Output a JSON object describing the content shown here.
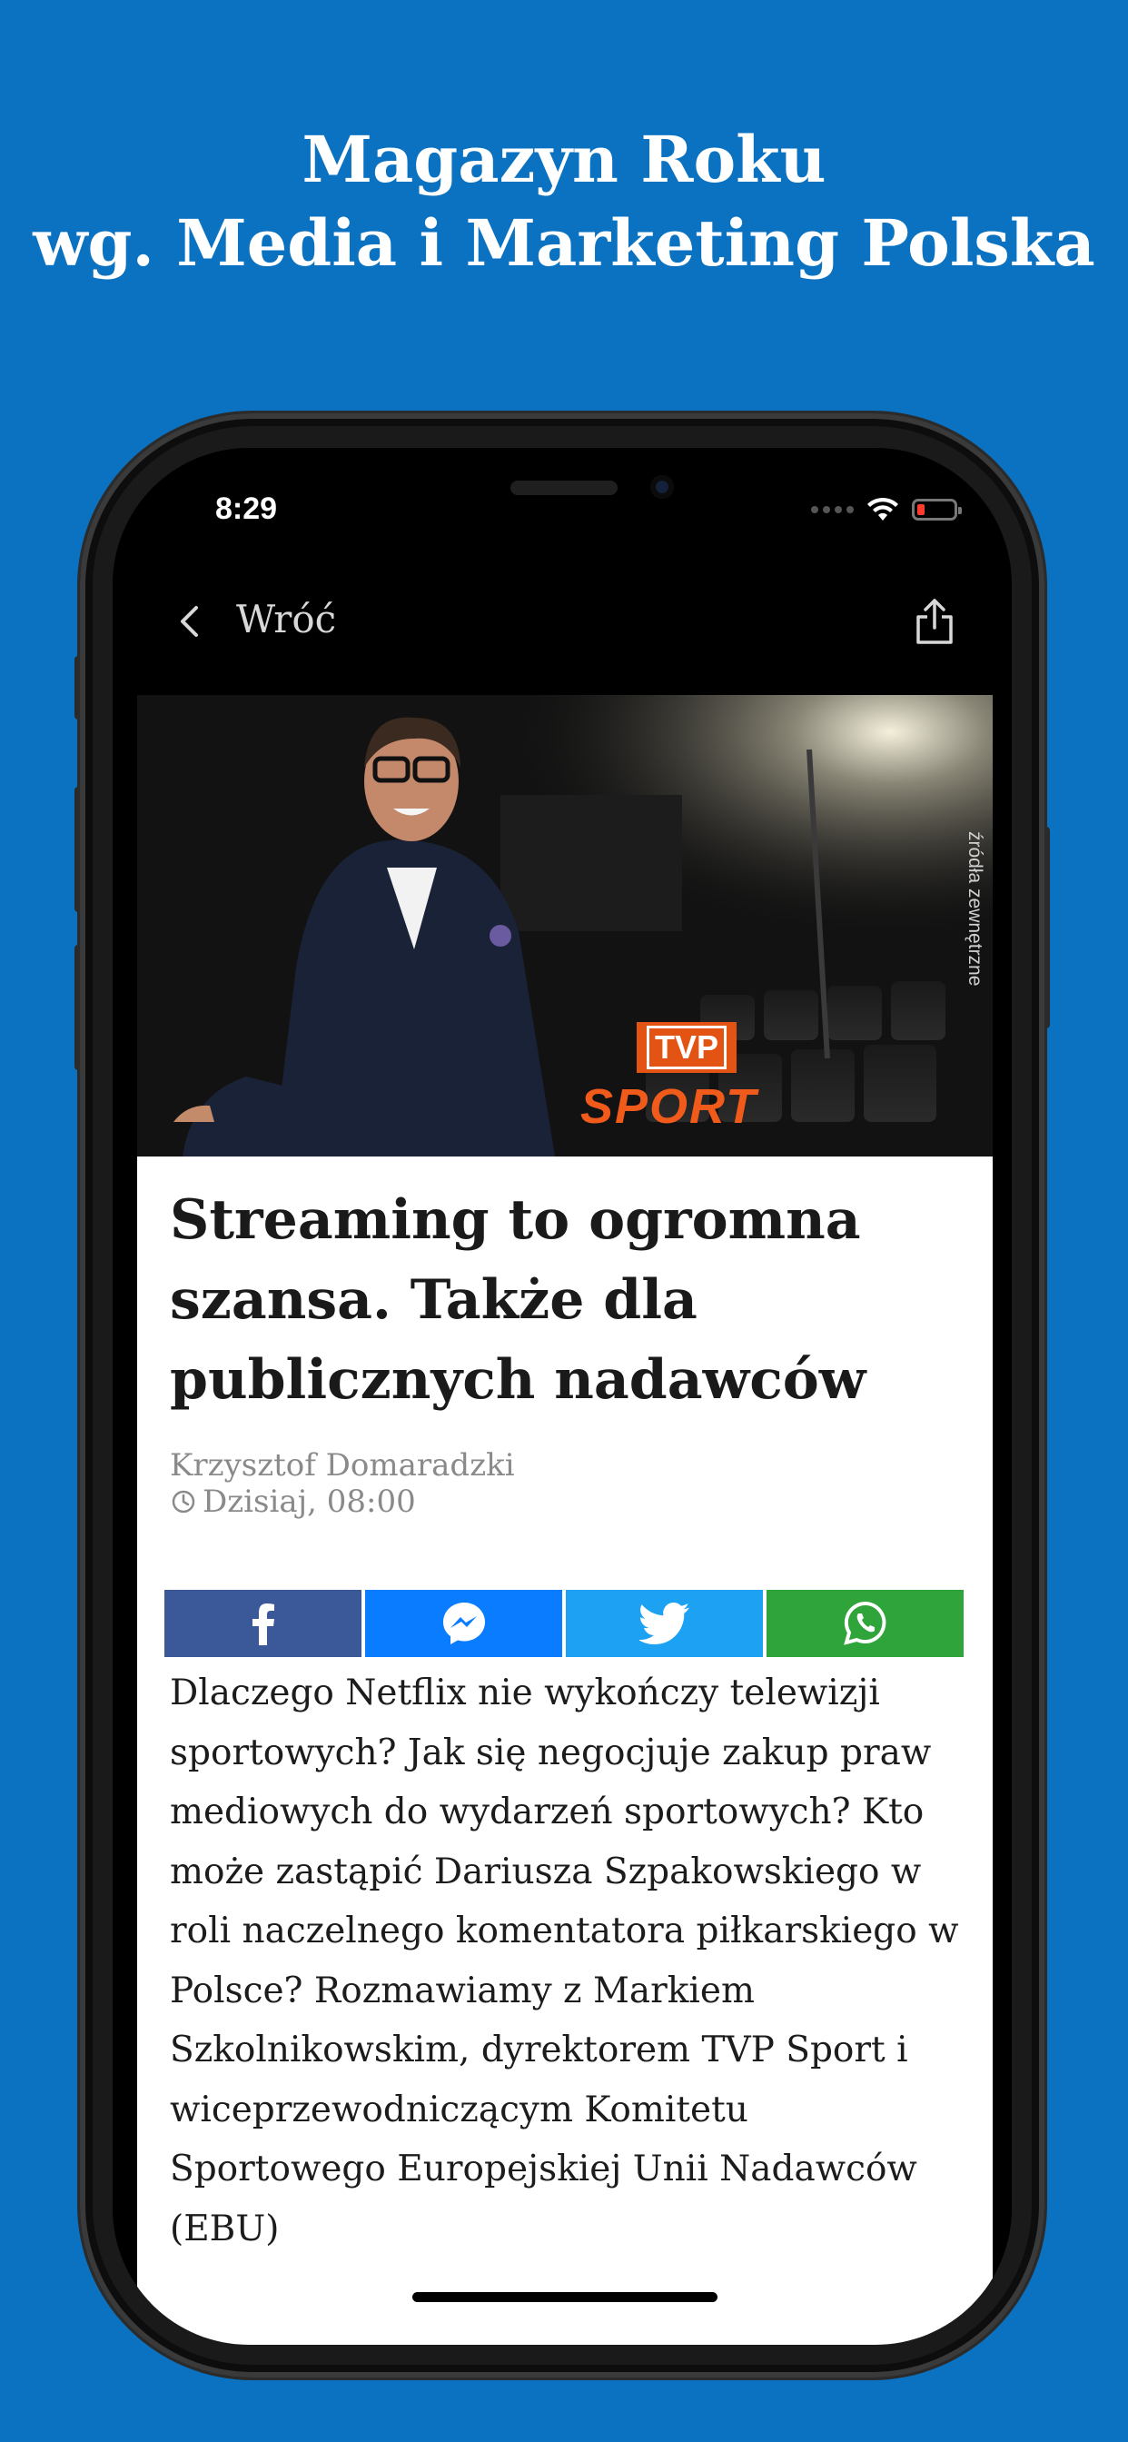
{
  "promo": {
    "line1": "Magazyn Roku",
    "line2": "wg. Media i Marketing Polska"
  },
  "status_bar": {
    "time": "8:29"
  },
  "nav": {
    "back_label": "Wróć",
    "back_icon": "chevron-left-icon",
    "share_icon": "share-icon"
  },
  "hero": {
    "caption": "źródła zewnętrzne",
    "logo_text": "TVP",
    "logo_sub": "SPORT"
  },
  "article": {
    "title": "Streaming to ogromna szansa. Także dla publicznych nadawców",
    "author": "Krzysztof Domaradzki",
    "date": "Dzisiaj, 08:00",
    "body": "Dlaczego Netflix nie wykończy telewizji sportowych? Jak się negocjuje zakup praw mediowych do wydarzeń sportowych? Kto może zastąpić Dariusza Szpakowskiego w roli naczelnego komentatora piłkarskiego w Polsce? Rozmawiamy z Markiem Szkolnikowskim, dyrektorem TVP Sport i wiceprzewodniczącym Komitetu Sportowego Europejskiej Unii Nadawców (EBU)"
  },
  "share_buttons": [
    {
      "name": "facebook",
      "icon": "facebook-icon",
      "color": "#3b5998"
    },
    {
      "name": "messenger",
      "icon": "messenger-icon",
      "color": "#0a7cff"
    },
    {
      "name": "twitter",
      "icon": "twitter-icon",
      "color": "#1da1f2"
    },
    {
      "name": "whatsapp",
      "icon": "whatsapp-icon",
      "color": "#2ea43a"
    }
  ],
  "colors": {
    "background": "#0a72c0",
    "battery_low": "#ff3b30",
    "tvp_orange": "#e35313"
  }
}
